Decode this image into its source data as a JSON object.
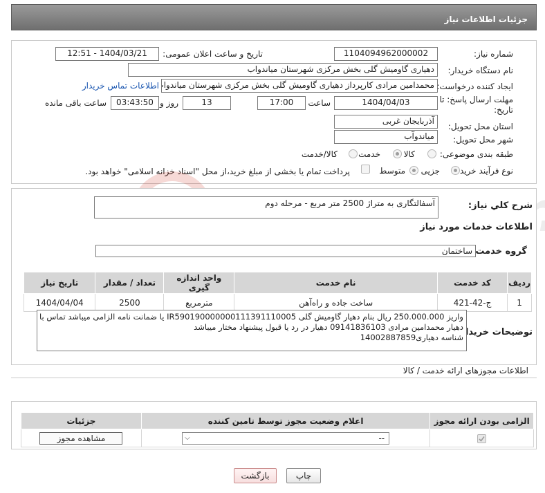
{
  "header": {
    "title": "جزئیات اطلاعات نیاز"
  },
  "fields": {
    "need_number_label": "شماره نیاز:",
    "need_number": "1104094962000002",
    "announce_label": "تاریخ و ساعت اعلان عمومی:",
    "announce_value": "1404/03/21 - 12:51",
    "buyer_org_label": "نام دستگاه خریدار:",
    "buyer_org": "دهیاری گاومیش گلی بخش مرکزی شهرستان میاندواب",
    "creator_label": "ایجاد کننده درخواست:",
    "creator": "محمدامین مرادی کارپرداز دهیاری گاومیش گلی بخش مرکزی شهرستان میاندواب",
    "contact_link": "اطلاعات تماس خریدار",
    "deadline_label_1": "مهلت ارسال پاسخ: تا",
    "deadline_label_2": "تاریخ:",
    "deadline_date": "1404/04/03",
    "time_label": "ساعت",
    "deadline_time": "17:00",
    "days_value": "13",
    "days_label": "روز و",
    "remaining_time": "03:43:50",
    "remaining_label": "ساعت باقی مانده",
    "province_label": "استان محل تحویل:",
    "province": "آذربایجان غربی",
    "city_label": "شهر محل تحویل:",
    "city": "میاندوآب",
    "category_label": "طبقه بندی موضوعی:",
    "category_options": [
      "کالا",
      "خدمت",
      "کالا/خدمت"
    ],
    "category_selected": 1,
    "process_label": "نوع فرآیند خرید :",
    "process_options": [
      "جزیی",
      "متوسط"
    ],
    "process_selected": 0,
    "payment_note": "پرداخت تمام یا بخشی از مبلغ خرید،از محل \"اسناد خزانه اسلامی\" خواهد بود."
  },
  "summary": {
    "label": "شرح کلي نياز:",
    "value": "آسفالتگاری به متراژ 2500 متر مربع - مرحله دوم"
  },
  "services": {
    "section_title": "اطلاعات خدمات مورد نياز",
    "group_label": "گروه خدمت:",
    "group_value": "ساختمان",
    "columns": [
      "رديف",
      "کد خدمت",
      "نام خدمت",
      "واحد اندازه گیری",
      "تعداد / مقدار",
      "تاریخ نیاز"
    ],
    "rows": [
      [
        "1",
        "ج-42-421",
        "ساخت جاده و راه‌آهن",
        "مترمربع",
        "2500",
        "1404/04/04"
      ]
    ]
  },
  "buyer_notes": {
    "label": "توضیحات خریدار:",
    "line1": "واریز 250.000.000 ریال بنام دهیار گاومیش گلی IR590190000000111391110005 یا ضمانت نامه الزامی میباشد تماس با",
    "line2": "دهیار محمدامین مرادی 09141836103 دهیار در رد یا قبول پیشنهاد مختار میباشد",
    "line3": "شناسه دهیاری14002887859"
  },
  "permits": {
    "section_title": "اطلاعات مجوزهای ارائه خدمت / کالا",
    "columns": [
      "الزامی بودن ارائه مجوز",
      "اعلام وضعیت مجوز توسط تامین کننده",
      "جزئیات"
    ],
    "select_value": "--",
    "view_button": "مشاهده مجوز"
  },
  "footer": {
    "print_button": "چاپ",
    "back_button": "بازگشت"
  },
  "colors": {
    "title_bar": "#7f7f7f",
    "link": "#1a56b0",
    "table_header": "#d6d6d6"
  }
}
